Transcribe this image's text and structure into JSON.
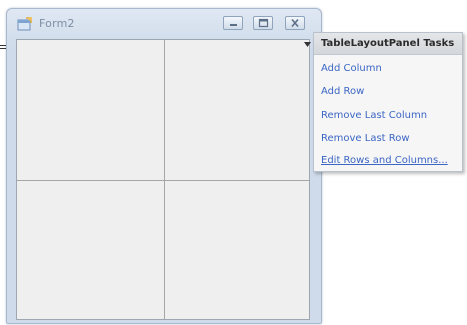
{
  "form": {
    "title": "Form2",
    "app_icon": "form-icon",
    "buttons": {
      "minimize": "minimize-icon",
      "maximize": "maximize-icon",
      "close": "close-icon"
    },
    "grid": {
      "columns": 2,
      "rows": 2
    }
  },
  "tasks_panel": {
    "title": "TableLayoutPanel Tasks",
    "items": [
      {
        "label": "Add Column"
      },
      {
        "label": "Add Row"
      },
      {
        "label": "Remove Last Column"
      },
      {
        "label": "Remove Last Row"
      },
      {
        "label": "Edit Rows and Columns..."
      }
    ]
  },
  "colors": {
    "link": "#3b66c4",
    "panel_background": "#efefef",
    "grid_line": "#a6a6a6"
  }
}
